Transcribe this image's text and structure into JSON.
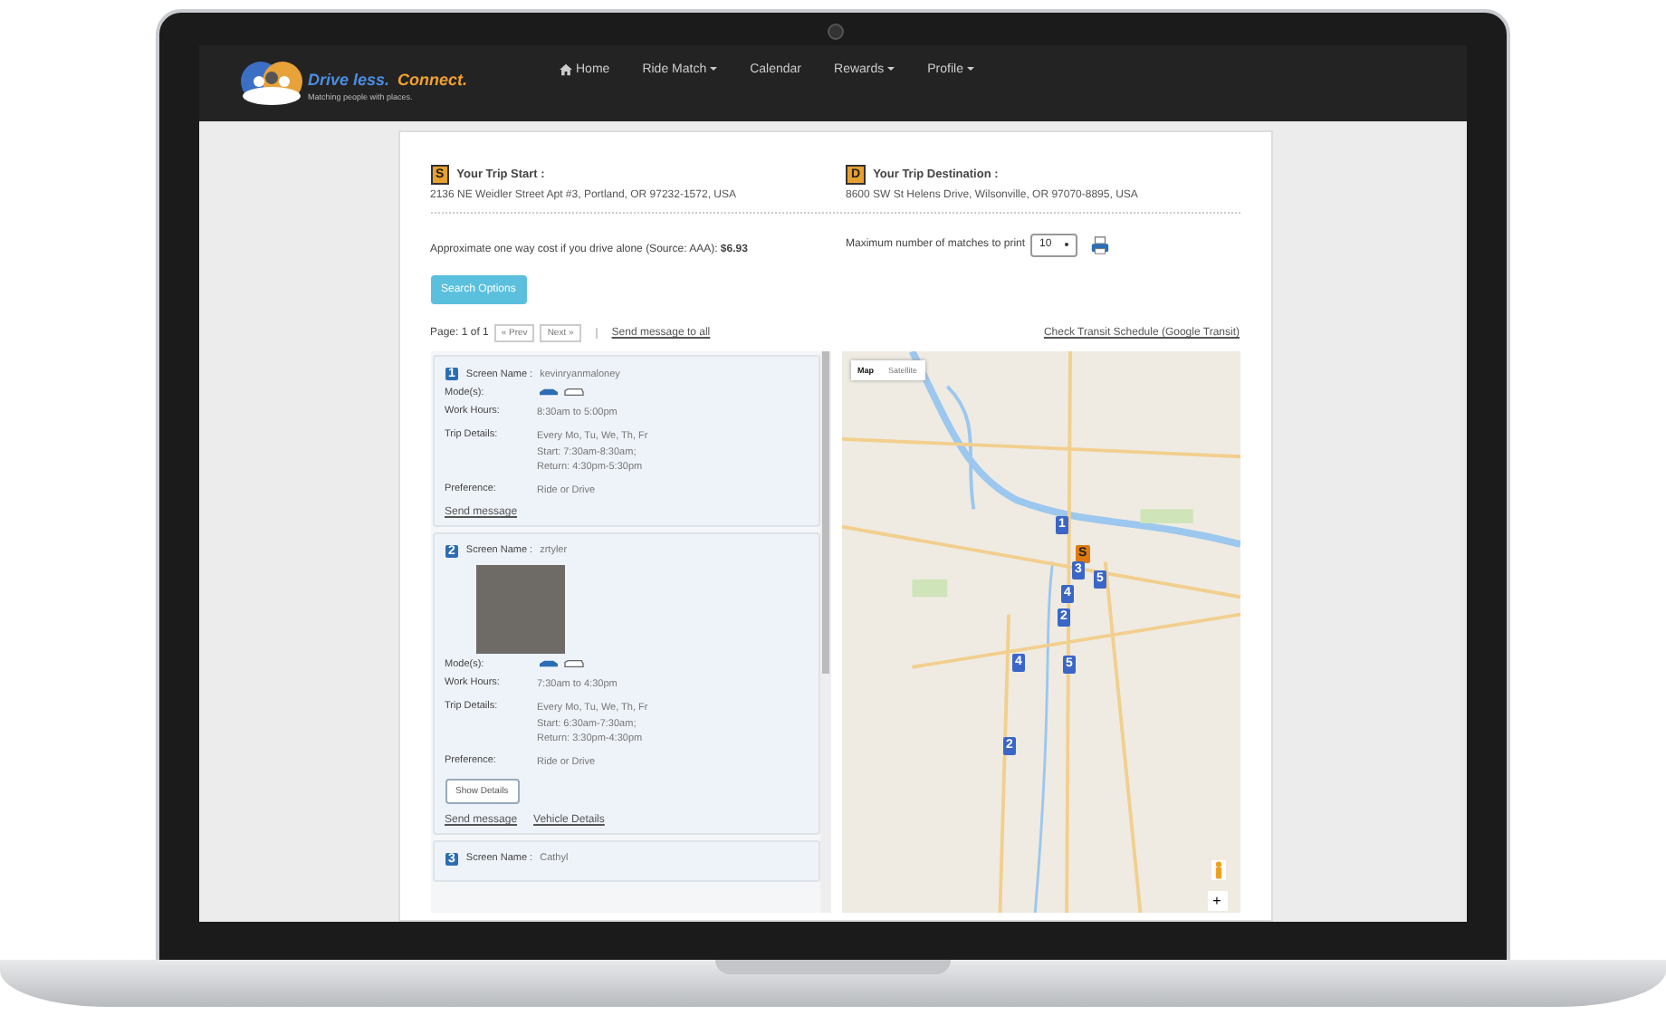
{
  "brand": {
    "name": "Drive less.",
    "accent": "Connect.",
    "tagline": "Matching people with places."
  },
  "nav": [
    {
      "label": "Home",
      "kind": "home",
      "dropdown": false
    },
    {
      "label": "Ride Match",
      "kind": "link",
      "dropdown": true
    },
    {
      "label": "Calendar",
      "kind": "link",
      "dropdown": false
    },
    {
      "label": "Rewards",
      "kind": "link",
      "dropdown": true
    },
    {
      "label": "Profile",
      "kind": "link",
      "dropdown": true
    }
  ],
  "trip": {
    "start": {
      "badge": "S",
      "title": "Your Trip Start :",
      "address": "2136 NE Weidler Street Apt #3, Portland, OR 97232-1572, USA"
    },
    "destination": {
      "badge": "D",
      "title": "Your Trip Destination :",
      "address": "8600 SW St Helens Drive, Wilsonville, OR 97070-8895, USA"
    },
    "cost_label": "Approximate one way cost if you drive alone (Source: AAA):",
    "cost": "$6.93",
    "max_label": "Maximum number of matches to print",
    "max_value": "10"
  },
  "search_button": "Search Options",
  "pager": {
    "page": "Page: 1 of 1",
    "prev": "« Prev",
    "next": "Next »",
    "message_all": "Send message to all",
    "transit": "Check Transit Schedule (Google Transit)"
  },
  "matches": [
    {
      "number": "1",
      "name_label": "Screen Name :",
      "screen_name": "kevinryanmaloney",
      "photo": false,
      "fields": [
        {
          "label": "Mode(s):",
          "kind": "modes"
        },
        {
          "label": "Work Hours:",
          "kind": "text",
          "lines": [
            "8:30am to 5:00pm"
          ]
        },
        {
          "label": "Trip Details:",
          "kind": "text",
          "lines": [
            "Every Mo, Tu, We, Th, Fr",
            "Start: 7:30am-8:30am;",
            "Return: 4:30pm-5:30pm"
          ]
        },
        {
          "label": "Preference:",
          "kind": "text",
          "lines": [
            "Ride or Drive"
          ]
        }
      ],
      "links": [
        "Send message"
      ]
    },
    {
      "number": "2",
      "name_label": "Screen Name :",
      "screen_name": "zrtyler",
      "photo": true,
      "fields": [
        {
          "label": "Mode(s):",
          "kind": "modes"
        },
        {
          "label": "Work Hours:",
          "kind": "text",
          "lines": [
            "7:30am to 4:30pm"
          ]
        },
        {
          "label": "Trip Details:",
          "kind": "text",
          "lines": [
            "Every Mo, Tu, We, Th, Fr",
            "Start: 6:30am-7:30am;",
            "Return: 3:30pm-4:30pm"
          ]
        },
        {
          "label": "Preference:",
          "kind": "text",
          "lines": [
            "Ride or Drive"
          ]
        }
      ],
      "show_details": "Show Details",
      "links": [
        "Send message",
        "Vehicle Details"
      ]
    },
    {
      "number": "3",
      "name_label": "Screen Name :",
      "screen_name": "Cathyl",
      "photo": false
    }
  ],
  "map": {
    "tabs": [
      {
        "label": "Map",
        "selected": true
      },
      {
        "label": "Satellite",
        "selected": false
      }
    ],
    "markers": [
      {
        "label": "1",
        "kind": "match"
      },
      {
        "label": "S",
        "kind": "start"
      },
      {
        "label": "3",
        "kind": "match"
      },
      {
        "label": "5",
        "kind": "match"
      },
      {
        "label": "4",
        "kind": "match"
      },
      {
        "label": "2",
        "kind": "match"
      },
      {
        "label": "4",
        "kind": "match"
      },
      {
        "label": "5",
        "kind": "match"
      },
      {
        "label": "2",
        "kind": "match"
      }
    ],
    "zoom_in": "+"
  }
}
